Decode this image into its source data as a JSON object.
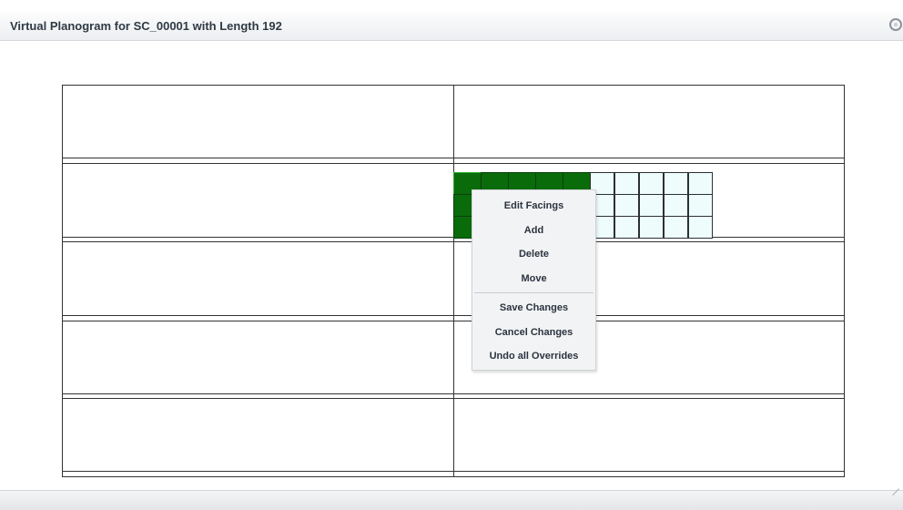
{
  "dialog": {
    "title": "Virtual Planogram for SC_00001 with Length 192",
    "close_icon": "close-circle-icon",
    "resize_icon": "resize-grip-icon"
  },
  "planogram": {
    "bays": 2,
    "shelves": 5,
    "facings": {
      "shelf_index": 1,
      "bay_index": 1,
      "rows": 3,
      "selected_columns": 5,
      "unselected_columns": 5,
      "selected_color": "#0a6b0a",
      "unselected_color": "#eefcfc"
    }
  },
  "context_menu": {
    "group1": [
      "Edit Facings",
      "Add",
      "Delete",
      "Move"
    ],
    "group2": [
      "Save Changes",
      "Cancel Changes",
      "Undo all Overrides"
    ]
  }
}
